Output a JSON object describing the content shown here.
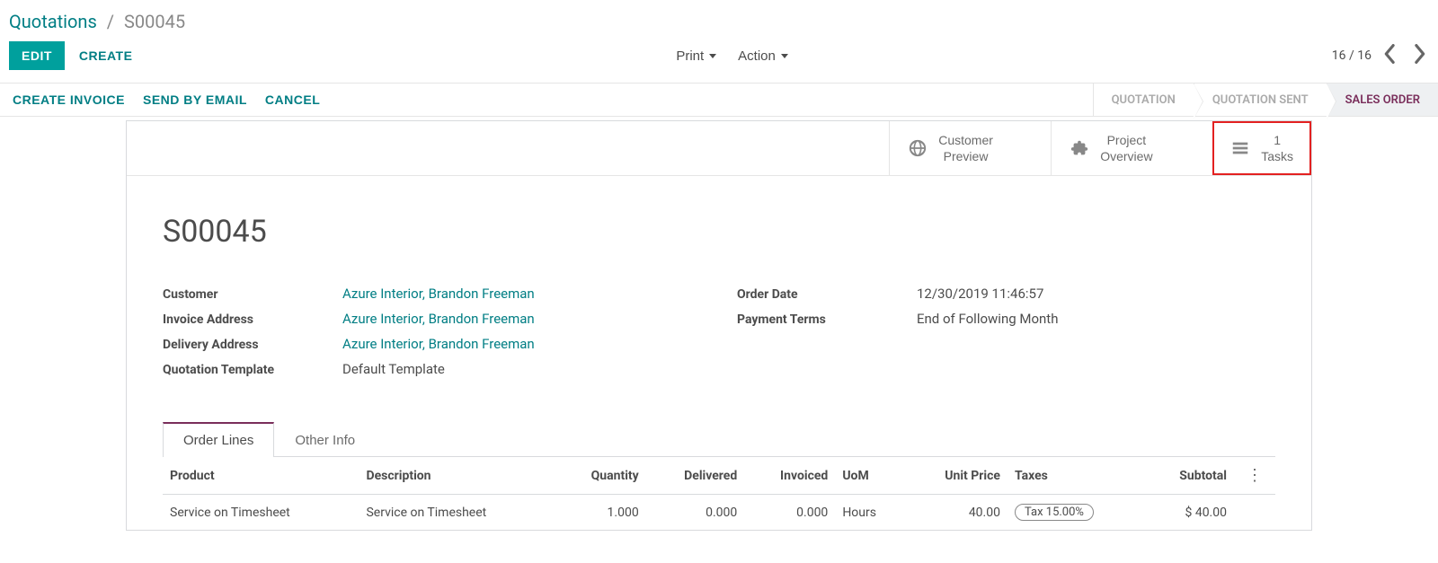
{
  "breadcrumb": {
    "root": "Quotations",
    "current": "S00045"
  },
  "toolbar": {
    "edit": "EDIT",
    "create": "CREATE",
    "print": "Print",
    "action": "Action",
    "pager": "16 / 16"
  },
  "actions": {
    "create_invoice": "CREATE INVOICE",
    "send_email": "SEND BY EMAIL",
    "cancel": "CANCEL"
  },
  "status_steps": {
    "quotation": "QUOTATION",
    "quotation_sent": "QUOTATION SENT",
    "sales_order": "SALES ORDER"
  },
  "stat_buttons": {
    "customer_preview": {
      "line1": "Customer",
      "line2": "Preview"
    },
    "project_overview": {
      "line1": "Project",
      "line2": "Overview"
    },
    "tasks": {
      "count": "1",
      "label": "Tasks"
    }
  },
  "record": {
    "title": "S00045",
    "labels": {
      "customer": "Customer",
      "invoice_address": "Invoice Address",
      "delivery_address": "Delivery Address",
      "quotation_template": "Quotation Template",
      "order_date": "Order Date",
      "payment_terms": "Payment Terms"
    },
    "values": {
      "customer": "Azure Interior, Brandon Freeman",
      "invoice_address": "Azure Interior, Brandon Freeman",
      "delivery_address": "Azure Interior, Brandon Freeman",
      "quotation_template": "Default Template",
      "order_date": "12/30/2019 11:46:57",
      "payment_terms": "End of Following Month"
    }
  },
  "tabs": {
    "order_lines": "Order Lines",
    "other_info": "Other Info"
  },
  "order_lines": {
    "headers": {
      "product": "Product",
      "description": "Description",
      "quantity": "Quantity",
      "delivered": "Delivered",
      "invoiced": "Invoiced",
      "uom": "UoM",
      "unit_price": "Unit Price",
      "taxes": "Taxes",
      "subtotal": "Subtotal"
    },
    "rows": [
      {
        "product": "Service on Timesheet",
        "description": "Service on Timesheet",
        "quantity": "1.000",
        "delivered": "0.000",
        "invoiced": "0.000",
        "uom": "Hours",
        "unit_price": "40.00",
        "taxes": "Tax 15.00%",
        "subtotal": "$ 40.00"
      }
    ]
  }
}
